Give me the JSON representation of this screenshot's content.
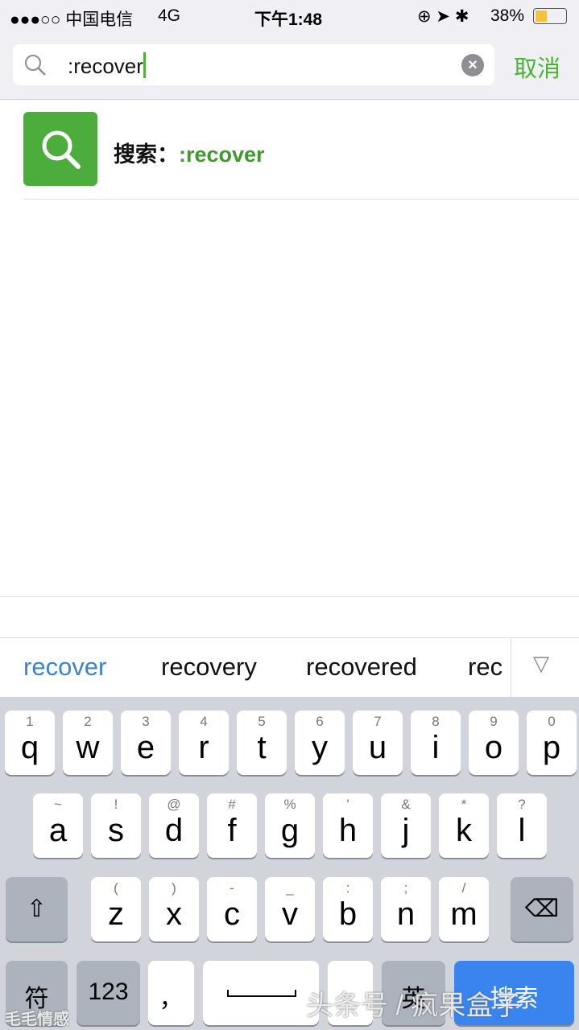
{
  "status": {
    "carrier": "●●●○○ 中国电信",
    "network": "4G",
    "time": "下午1:48",
    "battery": "38%"
  },
  "search": {
    "query": ":recover",
    "cancel": "取消"
  },
  "result": {
    "prefix": "搜索：",
    "query": ":recover"
  },
  "suggestions": [
    "recover",
    "recovery",
    "recovered",
    "rec"
  ],
  "colors": {
    "accent": "#4cb336",
    "suggestion_active": "#3a84d0",
    "search_key": "#3a84f0"
  },
  "keyboard": {
    "row1": [
      [
        "q",
        "1"
      ],
      [
        "w",
        "2"
      ],
      [
        "e",
        "3"
      ],
      [
        "r",
        "4"
      ],
      [
        "t",
        "5"
      ],
      [
        "y",
        "6"
      ],
      [
        "u",
        "7"
      ],
      [
        "i",
        "8"
      ],
      [
        "o",
        "9"
      ],
      [
        "p",
        "0"
      ]
    ],
    "row2": [
      [
        "a",
        "~"
      ],
      [
        "s",
        "!"
      ],
      [
        "d",
        "@"
      ],
      [
        "f",
        "#"
      ],
      [
        "g",
        "%"
      ],
      [
        "h",
        "'"
      ],
      [
        "j",
        "&"
      ],
      [
        "k",
        "*"
      ],
      [
        "l",
        "?"
      ]
    ],
    "row3": [
      [
        "z",
        "("
      ],
      [
        "x",
        ")"
      ],
      [
        "c",
        "-"
      ],
      [
        "v",
        "_"
      ],
      [
        "b",
        ":"
      ],
      [
        "n",
        ";"
      ],
      [
        "m",
        "/"
      ]
    ],
    "symbols": "符",
    "numbers": "123",
    "comma": "，",
    "lang": "英",
    "search": "搜索"
  },
  "watermarks": [
    "头条号 / 疯果盒子",
    "毛毛情感"
  ]
}
